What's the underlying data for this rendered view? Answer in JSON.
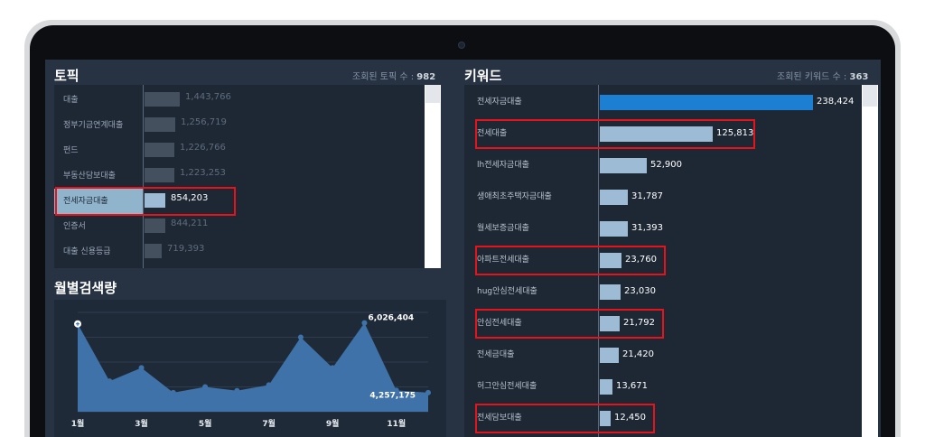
{
  "topic_panel": {
    "title": "토픽",
    "count_label": "조회된 토픽 수 :",
    "count_value": "982",
    "rows": [
      {
        "label": "대출",
        "value": "1,443,766",
        "share": 0.169
      },
      {
        "label": "정부기금연계대출",
        "value": "1,256,719",
        "share": 0.147
      },
      {
        "label": "펀드",
        "value": "1,226,766",
        "share": 0.143
      },
      {
        "label": "부동산담보대출",
        "value": "1,223,253",
        "share": 0.143
      },
      {
        "label": "전세자금대출",
        "value": "854,203",
        "share": 0.1,
        "highlighted": true
      },
      {
        "label": "인증서",
        "value": "844,211",
        "share": 0.099
      },
      {
        "label": "대출 신용등급",
        "value": "719,393",
        "share": 0.084
      }
    ]
  },
  "monthly_panel": {
    "title": "월별검색량",
    "chart_data": {
      "type": "area",
      "x": [
        "1월",
        "2월",
        "3월",
        "4월",
        "5월",
        "6월",
        "7월",
        "8월",
        "9월",
        "10월",
        "11월",
        "12월"
      ],
      "x_tick_labels": [
        "1월",
        "3월",
        "5월",
        "7월",
        "9월",
        "11월"
      ],
      "values": [
        6000000,
        4500000,
        4850000,
        4200000,
        4350000,
        4250000,
        4400000,
        5650000,
        4850000,
        6026404,
        4257175,
        4200000
      ],
      "data_labels": [
        {
          "index": 9,
          "text": "6,026,404"
        },
        {
          "index": 10,
          "text": "4,257,175"
        }
      ],
      "ylim": [
        3700000,
        6300000
      ],
      "color": "#3f72a8",
      "grid": true
    }
  },
  "keyword_panel": {
    "title": "키워드",
    "count_label": "조회된 키워드 수 :",
    "count_value": "363",
    "max_value": 238424,
    "rows": [
      {
        "label": "전세자금대출",
        "value": "238,424",
        "num": 238424,
        "top": true
      },
      {
        "label": "전세대출",
        "value": "125,813",
        "num": 125813,
        "highlighted": true
      },
      {
        "label": "lh전세자금대출",
        "value": "52,900",
        "num": 52900
      },
      {
        "label": "생애최초주택자금대출",
        "value": "31,787",
        "num": 31787
      },
      {
        "label": "월세보증금대출",
        "value": "31,393",
        "num": 31393
      },
      {
        "label": "아파트전세대출",
        "value": "23,760",
        "num": 23760,
        "highlighted": true
      },
      {
        "label": "hug안심전세대출",
        "value": "23,030",
        "num": 23030
      },
      {
        "label": "안심전세대출",
        "value": "21,792",
        "num": 21792,
        "highlighted": true
      },
      {
        "label": "전세금대출",
        "value": "21,420",
        "num": 21420
      },
      {
        "label": "허그안심전세대출",
        "value": "13,671",
        "num": 13671
      },
      {
        "label": "전세담보대출",
        "value": "12,450",
        "num": 12450,
        "highlighted": true
      }
    ]
  },
  "colors": {
    "screen_bg": "#273342",
    "panel_bg": "#1e2835",
    "bar_muted": "#44505e",
    "bar_light": "#9dbbd4",
    "bar_top": "#1d7fd1",
    "highlight_box": "#e8121a"
  }
}
